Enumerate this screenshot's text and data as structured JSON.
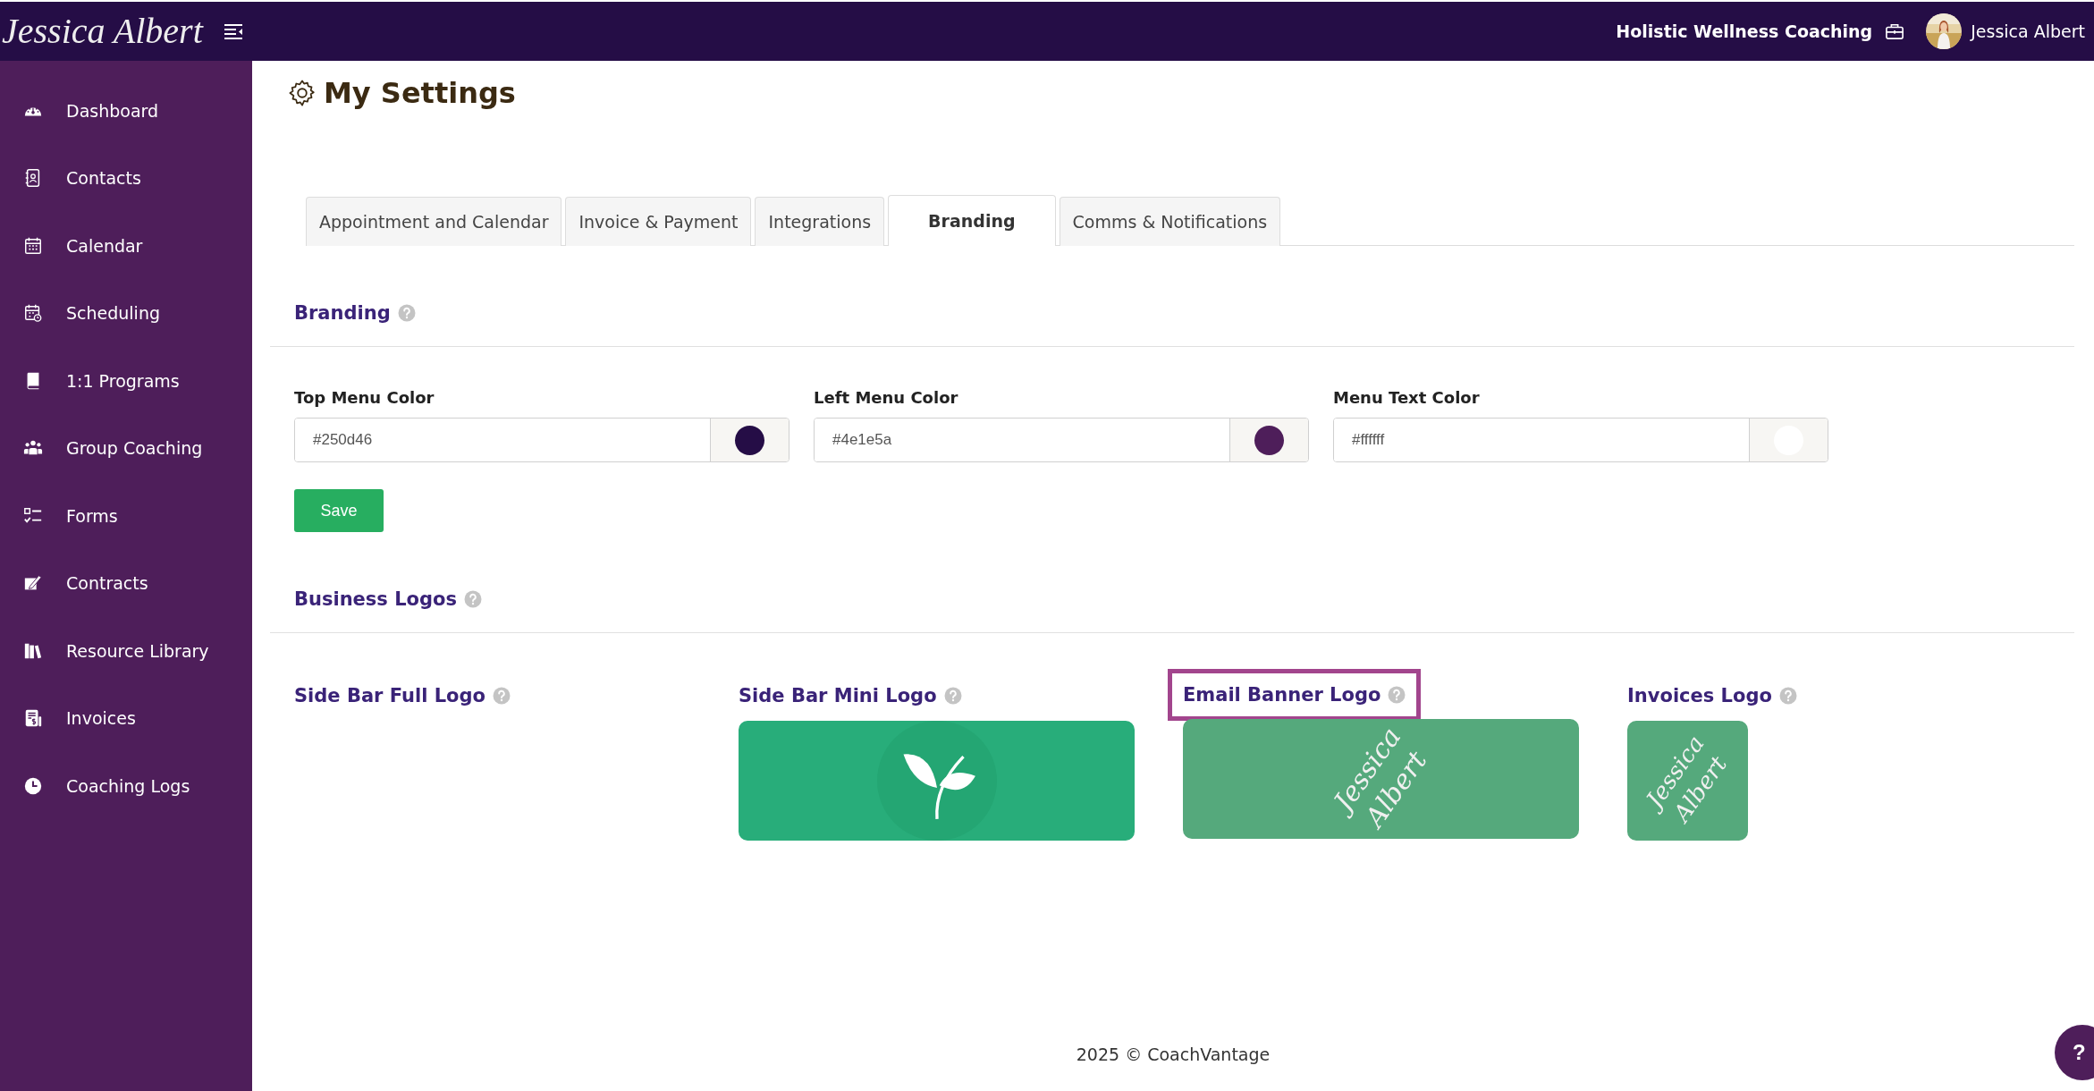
{
  "topbar": {
    "brand": "Jessica Albert",
    "business": "Holistic Wellness Coaching",
    "user": "Jessica Albert"
  },
  "sidebar": {
    "items": [
      {
        "label": "Dashboard",
        "selected": false
      },
      {
        "label": "Contacts",
        "selected": false
      },
      {
        "label": "Calendar",
        "selected": false
      },
      {
        "label": "Scheduling",
        "selected": false
      },
      {
        "label": "1:1 Programs",
        "selected": false
      },
      {
        "label": "Group Coaching",
        "selected": false
      },
      {
        "label": "Forms",
        "selected": false
      },
      {
        "label": "Contracts",
        "selected": false
      },
      {
        "label": "Resource Library",
        "selected": false
      },
      {
        "label": "Invoices",
        "selected": false
      },
      {
        "label": "Coaching Logs",
        "selected": false
      }
    ]
  },
  "page": {
    "title": "My Settings"
  },
  "tabs": [
    {
      "label": "Appointment and Calendar",
      "selected": false
    },
    {
      "label": "Invoice & Payment",
      "selected": false
    },
    {
      "label": "Integrations",
      "selected": false
    },
    {
      "label": "Branding",
      "selected": true
    },
    {
      "label": "Comms & Notifications",
      "selected": false
    }
  ],
  "branding": {
    "heading": "Branding",
    "fields": [
      {
        "label": "Top Menu Color",
        "value": "#250d46",
        "color": "#250d46"
      },
      {
        "label": "Left Menu Color",
        "value": "#4e1e5a",
        "color": "#4e1e5a"
      },
      {
        "label": "Menu Text Color",
        "value": "#ffffff",
        "color": "#ffffff"
      }
    ],
    "save_button": "Save"
  },
  "business_logos": {
    "heading": "Business Logos",
    "logos": [
      {
        "label": "Side Bar Full Logo",
        "kind": "empty",
        "highlighted": false
      },
      {
        "label": "Side Bar Mini Logo",
        "kind": "leaf",
        "highlighted": false
      },
      {
        "label": "Email Banner Logo",
        "kind": "script",
        "logo_text": "Jessica Albert",
        "highlighted": true
      },
      {
        "label": "Invoices Logo",
        "kind": "script",
        "logo_text": "Jessica Albert",
        "highlighted": false
      }
    ]
  },
  "footer": "2025 © CoachVantage",
  "help_button": "?"
}
